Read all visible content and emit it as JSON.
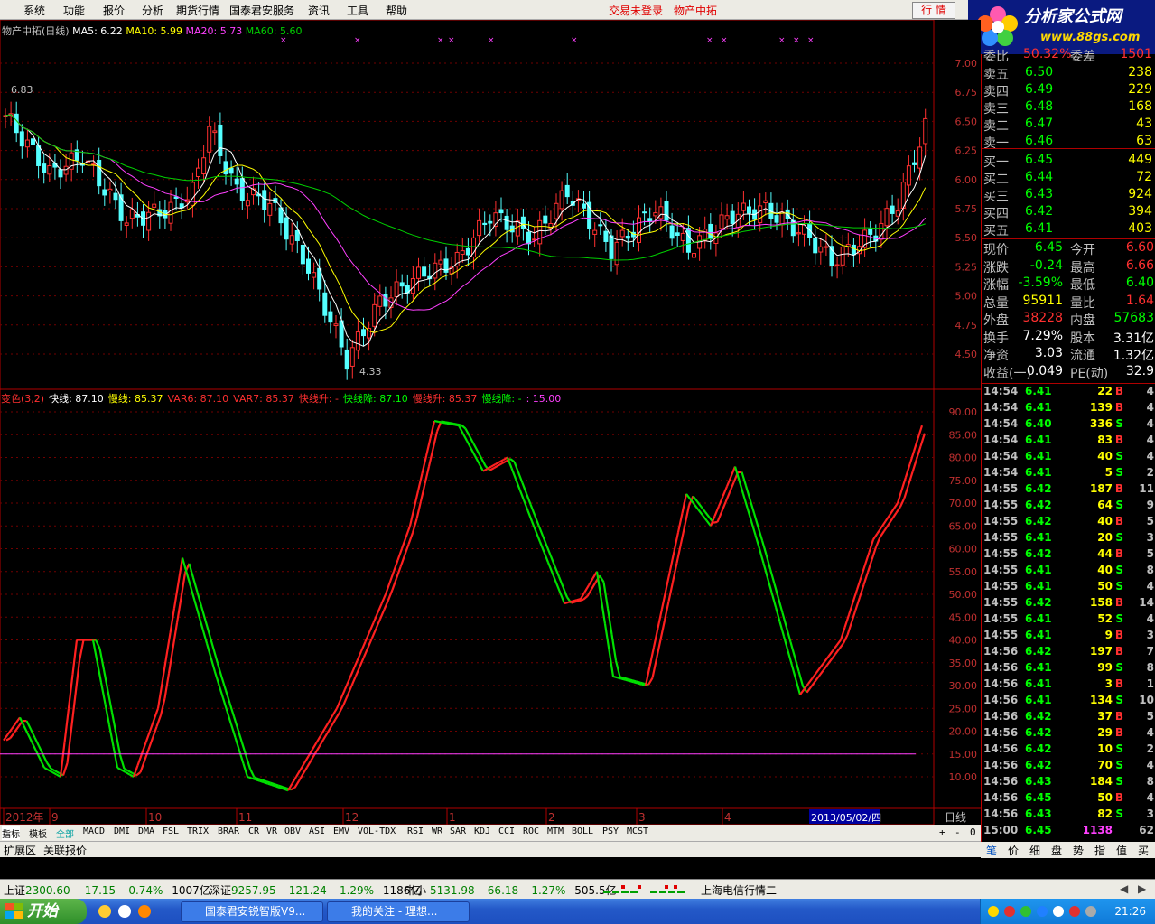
{
  "menu": {
    "items": [
      "系统",
      "功能",
      "报价",
      "分析",
      "期货行情",
      "国泰君安服务",
      "资讯",
      "工具",
      "帮助"
    ],
    "login_status": "交易未登录",
    "stock_name": "物产中拓",
    "hq_button": "行 情"
  },
  "logo": {
    "title": "分析家公式网",
    "url": "www.88gs.com"
  },
  "price_panel": {
    "legend_name": "物产中拓(日线)",
    "ma5": "MA5: 6.22",
    "ma10": "MA10: 5.99",
    "ma20": "MA20: 5.73",
    "ma60": "MA60: 5.60",
    "high_label": "6.83",
    "low_label": "4.33",
    "axis": [
      "7.00",
      "6.75",
      "6.50",
      "6.25",
      "6.00",
      "5.75",
      "5.50",
      "5.25",
      "5.00",
      "4.75",
      "4.50"
    ],
    "colors": {
      "up": "#ff3030",
      "down": "#54ffff",
      "ma5": "#ffffff",
      "ma10": "#ffff00",
      "ma20": "#ff40ff",
      "ma60": "#00d000"
    }
  },
  "indicator_panel": {
    "legend": [
      {
        "text": "变色(3,2)",
        "color": "#ff3030"
      },
      {
        "text": "快线: 87.10",
        "color": "#ffffff"
      },
      {
        "text": "慢线: 85.37",
        "color": "#ffff00"
      },
      {
        "text": "VAR6: 87.10",
        "color": "#ff3030"
      },
      {
        "text": "VAR7: 85.37",
        "color": "#ff3030"
      },
      {
        "text": "快线升: -",
        "color": "#ff3030"
      },
      {
        "text": "快线降: 87.10",
        "color": "#00ff00"
      },
      {
        "text": "慢线升: 85.37",
        "color": "#ff3030"
      },
      {
        "text": "慢线降: -",
        "color": "#00ff00"
      },
      {
        "text": ": 15.00",
        "color": "#ff40ff"
      }
    ],
    "axis": [
      "90.00",
      "85.00",
      "80.00",
      "75.00",
      "70.00",
      "65.00",
      "60.00",
      "55.00",
      "50.00",
      "45.00",
      "40.00",
      "35.00",
      "30.00",
      "25.00",
      "20.00",
      "15.00",
      "10.00"
    ]
  },
  "time_axis": {
    "labels": [
      "2012年",
      "9",
      "10",
      "11",
      "12",
      "1",
      "2",
      "3",
      "4"
    ],
    "cursor_date": "2013/05/02/四",
    "period": "日线"
  },
  "indicator_tabs": [
    "指标",
    "模板",
    "全部",
    "MACD",
    "DMI",
    "DMA",
    "FSL",
    "TRIX",
    "BRAR",
    "CR",
    "VR",
    "OBV",
    "ASI",
    "EMV",
    "VOL-TDX",
    "RSI",
    "WR",
    "SAR",
    "KDJ",
    "CCI",
    "ROC",
    "MTM",
    "BOLL",
    "PSY",
    "MCST"
  ],
  "zoom_buttons": [
    "+",
    "-",
    "0"
  ],
  "ext_tabs": [
    "扩展区",
    "关联报价"
  ],
  "quote": {
    "header": {
      "label1": "委比",
      "v1": "50.32%",
      "label2": "委差",
      "v2": "1501"
    },
    "asks": [
      {
        "label": "卖五",
        "price": "6.50",
        "vol": "238"
      },
      {
        "label": "卖四",
        "price": "6.49",
        "vol": "229"
      },
      {
        "label": "卖三",
        "price": "6.48",
        "vol": "168"
      },
      {
        "label": "卖二",
        "price": "6.47",
        "vol": "43"
      },
      {
        "label": "卖一",
        "price": "6.46",
        "vol": "63"
      }
    ],
    "bids": [
      {
        "label": "买一",
        "price": "6.45",
        "vol": "449"
      },
      {
        "label": "买二",
        "price": "6.44",
        "vol": "72"
      },
      {
        "label": "买三",
        "price": "6.43",
        "vol": "924"
      },
      {
        "label": "买四",
        "price": "6.42",
        "vol": "394"
      },
      {
        "label": "买五",
        "price": "6.41",
        "vol": "403"
      }
    ],
    "stats": [
      {
        "l1": "现价",
        "v1": "6.45",
        "c1": "#00ff00",
        "l2": "今开",
        "v2": "6.60",
        "c2": "#ff3030"
      },
      {
        "l1": "涨跌",
        "v1": "-0.24",
        "c1": "#00ff00",
        "l2": "最高",
        "v2": "6.66",
        "c2": "#ff3030"
      },
      {
        "l1": "涨幅",
        "v1": "-3.59%",
        "c1": "#00ff00",
        "l2": "最低",
        "v2": "6.40",
        "c2": "#00ff00"
      },
      {
        "l1": "总量",
        "v1": "95911",
        "c1": "#ffff00",
        "l2": "量比",
        "v2": "1.64",
        "c2": "#ff3030"
      },
      {
        "l1": "外盘",
        "v1": "38228",
        "c1": "#ff3030",
        "l2": "内盘",
        "v2": "57683",
        "c2": "#00ff00"
      },
      {
        "l1": "换手",
        "v1": "7.29%",
        "c1": "#ffffff",
        "l2": "股本",
        "v2": "3.31亿",
        "c2": "#ffffff"
      },
      {
        "l1": "净资",
        "v1": "3.03",
        "c1": "#ffffff",
        "l2": "流通",
        "v2": "1.32亿",
        "c2": "#ffffff"
      },
      {
        "l1": "收益(一)",
        "v1": "0.049",
        "c1": "#ffffff",
        "l2": "PE(动)",
        "v2": "32.9",
        "c2": "#ffffff"
      }
    ],
    "ticks": [
      [
        "14:54",
        "6.41",
        "22",
        "B",
        "4"
      ],
      [
        "14:54",
        "6.41",
        "139",
        "B",
        "4"
      ],
      [
        "14:54",
        "6.40",
        "336",
        "S",
        "4"
      ],
      [
        "14:54",
        "6.41",
        "83",
        "B",
        "4"
      ],
      [
        "14:54",
        "6.41",
        "40",
        "S",
        "4"
      ],
      [
        "14:54",
        "6.41",
        "5",
        "S",
        "2"
      ],
      [
        "14:55",
        "6.42",
        "187",
        "B",
        "11"
      ],
      [
        "14:55",
        "6.42",
        "64",
        "S",
        "9"
      ],
      [
        "14:55",
        "6.42",
        "40",
        "B",
        "5"
      ],
      [
        "14:55",
        "6.41",
        "20",
        "S",
        "3"
      ],
      [
        "14:55",
        "6.42",
        "44",
        "B",
        "5"
      ],
      [
        "14:55",
        "6.41",
        "40",
        "S",
        "8"
      ],
      [
        "14:55",
        "6.41",
        "50",
        "S",
        "4"
      ],
      [
        "14:55",
        "6.42",
        "158",
        "B",
        "14"
      ],
      [
        "14:55",
        "6.41",
        "52",
        "S",
        "4"
      ],
      [
        "14:55",
        "6.41",
        "9",
        "B",
        "3"
      ],
      [
        "14:56",
        "6.42",
        "197",
        "B",
        "7"
      ],
      [
        "14:56",
        "6.41",
        "99",
        "S",
        "8"
      ],
      [
        "14:56",
        "6.41",
        "3",
        "B",
        "1"
      ],
      [
        "14:56",
        "6.41",
        "134",
        "S",
        "10"
      ],
      [
        "14:56",
        "6.42",
        "37",
        "B",
        "5"
      ],
      [
        "14:56",
        "6.42",
        "29",
        "B",
        "4"
      ],
      [
        "14:56",
        "6.42",
        "10",
        "S",
        "2"
      ],
      [
        "14:56",
        "6.42",
        "70",
        "S",
        "4"
      ],
      [
        "14:56",
        "6.43",
        "184",
        "S",
        "8"
      ],
      [
        "14:56",
        "6.45",
        "50",
        "B",
        "4"
      ],
      [
        "14:56",
        "6.43",
        "82",
        "S",
        "3"
      ],
      [
        "15:00",
        "6.45",
        "1138",
        "",
        "62"
      ]
    ]
  },
  "right_tabs": [
    "笔",
    "价",
    "细",
    "盘",
    "势",
    "指",
    "值",
    "买"
  ],
  "status": {
    "sh": {
      "name": "上证",
      "val": "2300.60",
      "chg": "-17.15",
      "pct": "-0.74%",
      "amt": "1007亿"
    },
    "sz": {
      "name": "深证",
      "val": "9257.95",
      "chg": "-121.24",
      "pct": "-1.29%",
      "amt": "1186亿"
    },
    "zx": {
      "name": "中小",
      "val": "5131.98",
      "chg": "-66.18",
      "pct": "-1.27%",
      "amt": "505.5亿"
    },
    "server": "上海电信行情二"
  },
  "taskbar": {
    "start": "开始",
    "tasks": [
      "国泰君安锐智版V9...",
      "我的关注 - 理想..."
    ],
    "clock": "21:26"
  }
}
